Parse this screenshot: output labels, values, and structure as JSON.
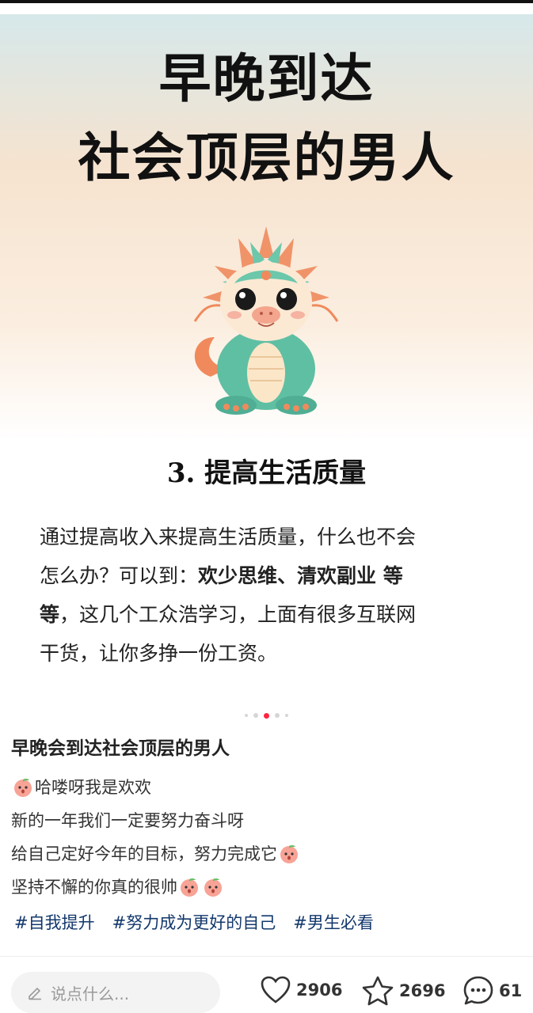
{
  "cover": {
    "title_line1": "早晚到达",
    "title_line2": "社会顶层的男人",
    "section_heading": "3. 提高生活质量",
    "body": {
      "p1": "通过提高收入来提高生活质量，什么也不会",
      "p2a": "怎么办？可以到：",
      "p2b": "欢少思维、清欢副业 等",
      "p3a": "等",
      "p3b": "，这几个工众浩学习，上面有很多互联网",
      "p4": "干货，让你多挣一份工资。"
    }
  },
  "pager": {
    "total": 5,
    "active_index": 2
  },
  "post": {
    "title": "早晚会到达社会顶层的男人",
    "lines": {
      "l1": "哈喽呀我是欢欢",
      "l2": "新的一年我们一定要努力奋斗呀",
      "l3": "给自己定好今年的目标，努力完成它",
      "l4": "坚持不懈的你真的很帅"
    },
    "tags": [
      "#自我提升",
      "#努力成为更好的自己",
      "#男生必看"
    ]
  },
  "bottom_bar": {
    "comment_placeholder": "说点什么...",
    "likes": "2906",
    "collects": "2696",
    "comments": "61"
  },
  "colors": {
    "accent": "#ff2442",
    "tag": "#13386c",
    "dragon_green": "#5fbfa3",
    "dragon_orange": "#f08a5d"
  }
}
